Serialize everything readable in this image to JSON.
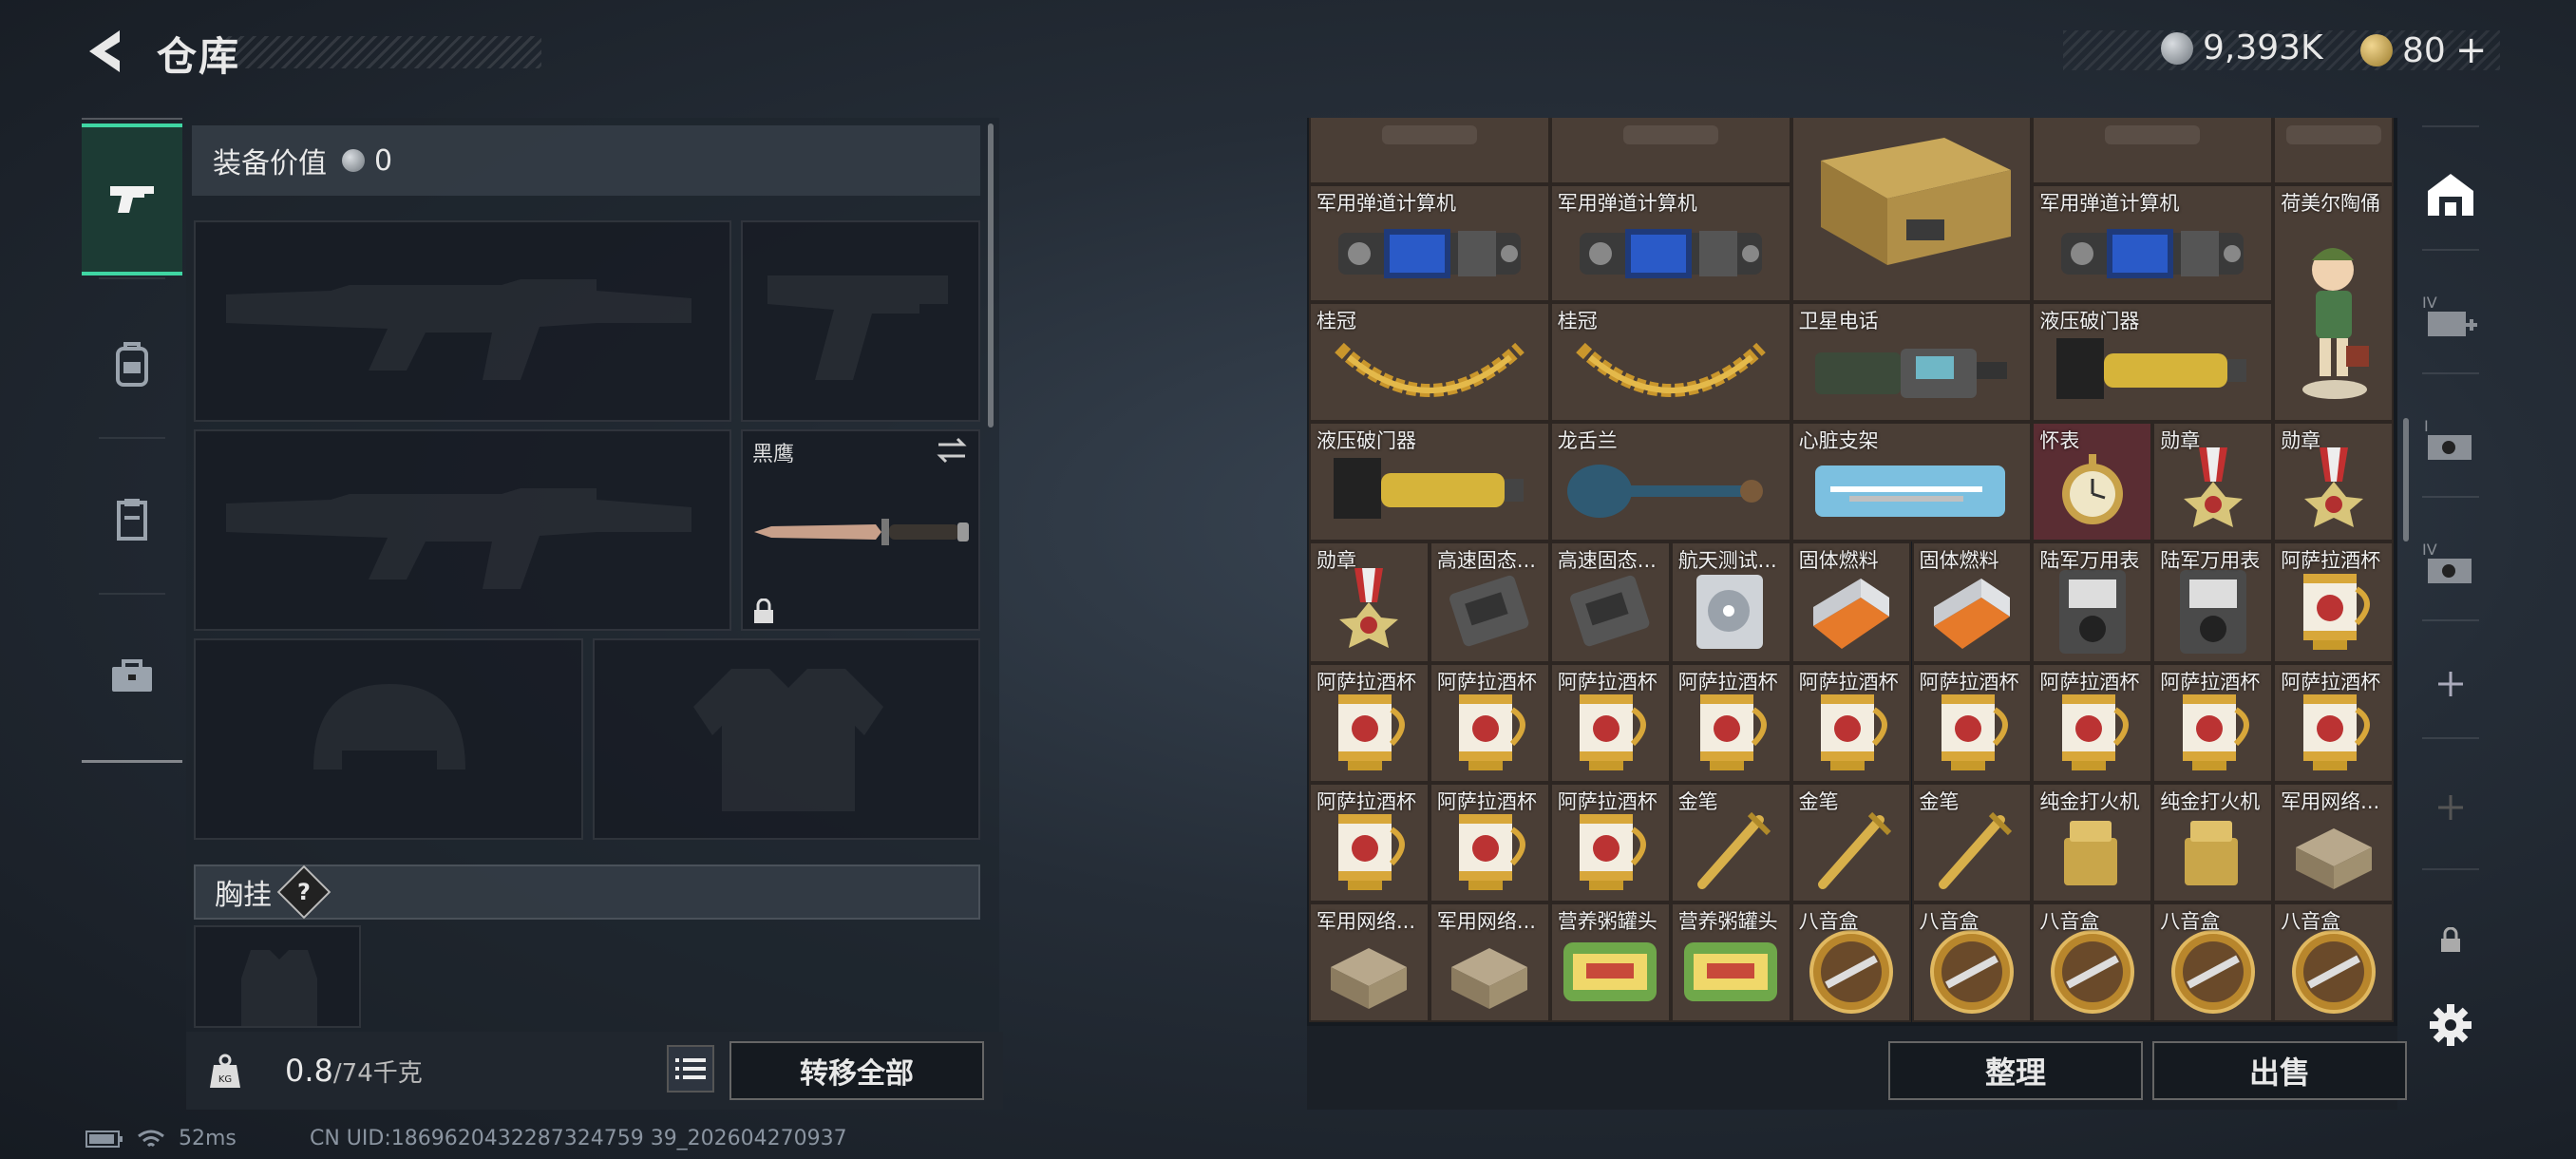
{
  "header": {
    "title": "仓库"
  },
  "currency": {
    "coins": "9,393K",
    "tickets": "80",
    "tickets_plus": "+"
  },
  "tabs": [
    {
      "name": "weapons",
      "icon": "pistol-icon"
    },
    {
      "name": "backpack",
      "icon": "backpack-icon"
    },
    {
      "name": "vest",
      "icon": "vest-icon"
    },
    {
      "name": "toolbox",
      "icon": "toolbox-icon"
    }
  ],
  "equipment": {
    "value_label": "装备价值",
    "value": "0",
    "melee_label": "黑鹰",
    "chest_label": "胸挂",
    "help": "?"
  },
  "bottom": {
    "weight_current": "0.8",
    "weight_max": "/74千克",
    "transfer_label": "转移全部"
  },
  "status": {
    "ping": "52ms",
    "uid": "CN UID:1869620432287324759 39_202604270937"
  },
  "inventory": {
    "items": [
      {
        "name": "",
        "kind": "partial"
      },
      {
        "name": "",
        "kind": "partial"
      },
      {
        "name": "",
        "kind": "crate"
      },
      {
        "name": "",
        "kind": "partial"
      },
      {
        "name": "",
        "kind": "partial"
      },
      {
        "name": "军用弹道计算机",
        "kind": "computer"
      },
      {
        "name": "军用弹道计算机",
        "kind": "computer"
      },
      {
        "name": "军用弹道计算机",
        "kind": "computer"
      },
      {
        "name": "荷美尔陶俑",
        "kind": "figurine"
      },
      {
        "name": "桂冠",
        "kind": "laurel"
      },
      {
        "name": "桂冠",
        "kind": "laurel"
      },
      {
        "name": "卫星电话",
        "kind": "satphone"
      },
      {
        "name": "液压破门器",
        "kind": "breacher"
      },
      {
        "name": "液压破门器",
        "kind": "breacher"
      },
      {
        "name": "龙舌兰",
        "kind": "bottle"
      },
      {
        "name": "心脏支架",
        "kind": "stent"
      },
      {
        "name": "怀表",
        "kind": "watch"
      },
      {
        "name": "勋章",
        "kind": "medal"
      },
      {
        "name": "勋章",
        "kind": "medal"
      },
      {
        "name": "勋章",
        "kind": "medal"
      },
      {
        "name": "高速固态...",
        "kind": "ssd"
      },
      {
        "name": "高速固态...",
        "kind": "ssd"
      },
      {
        "name": "航天测试...",
        "kind": "hdd"
      },
      {
        "name": "固体燃料",
        "kind": "fuel"
      },
      {
        "name": "固体燃料",
        "kind": "fuel"
      },
      {
        "name": "陆军万用表",
        "kind": "meter"
      },
      {
        "name": "陆军万用表",
        "kind": "meter"
      },
      {
        "name": "阿萨拉酒杯",
        "kind": "cup"
      },
      {
        "name": "阿萨拉酒杯",
        "kind": "cup"
      },
      {
        "name": "阿萨拉酒杯",
        "kind": "cup"
      },
      {
        "name": "阿萨拉酒杯",
        "kind": "cup"
      },
      {
        "name": "阿萨拉酒杯",
        "kind": "cup"
      },
      {
        "name": "阿萨拉酒杯",
        "kind": "cup"
      },
      {
        "name": "阿萨拉酒杯",
        "kind": "cup"
      },
      {
        "name": "阿萨拉酒杯",
        "kind": "cup"
      },
      {
        "name": "阿萨拉酒杯",
        "kind": "cup"
      },
      {
        "name": "阿萨拉酒杯",
        "kind": "cup"
      },
      {
        "name": "阿萨拉酒杯",
        "kind": "cup"
      },
      {
        "name": "阿萨拉酒杯",
        "kind": "cup"
      },
      {
        "name": "阿萨拉酒杯",
        "kind": "cup"
      },
      {
        "name": "金笔",
        "kind": "pen"
      },
      {
        "name": "金笔",
        "kind": "pen"
      },
      {
        "name": "金笔",
        "kind": "pen"
      },
      {
        "name": "纯金打火机",
        "kind": "lighter"
      },
      {
        "name": "纯金打火机",
        "kind": "lighter"
      },
      {
        "name": "军用网络...",
        "kind": "netbox"
      },
      {
        "name": "军用网络...",
        "kind": "netbox"
      },
      {
        "name": "军用网络...",
        "kind": "netbox"
      },
      {
        "name": "营养粥罐头",
        "kind": "can"
      },
      {
        "name": "营养粥罐头",
        "kind": "can"
      },
      {
        "name": "八音盒",
        "kind": "musicbox"
      },
      {
        "name": "八音盒",
        "kind": "musicbox"
      },
      {
        "name": "八音盒",
        "kind": "musicbox"
      },
      {
        "name": "八音盒",
        "kind": "musicbox"
      },
      {
        "name": "八音盒",
        "kind": "musicbox"
      }
    ],
    "organize_label": "整理",
    "sell_label": "出售"
  },
  "right_icons": [
    "warehouse-icon",
    "storage-iv-add-icon",
    "storage-i-icon",
    "storage-iv-icon",
    "add-storage-icon",
    "add-storage-disabled-icon",
    "lock-icon",
    "settings-icon"
  ]
}
